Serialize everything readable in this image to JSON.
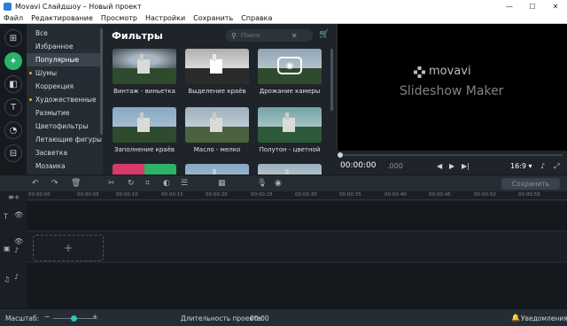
{
  "window": {
    "title": "Movavi Слайдшоу – Новый проект",
    "buttons": [
      "—",
      "☐",
      "✕"
    ]
  },
  "menu": [
    "Файл",
    "Редактирование",
    "Просмотр",
    "Настройки",
    "Сохранить",
    "Справка"
  ],
  "rail_tools": [
    "import-icon",
    "filters-icon",
    "transitions-icon",
    "titles-icon",
    "stickers-icon",
    "more-tools-icon"
  ],
  "categories": {
    "items": [
      {
        "label": "Все",
        "dot": false
      },
      {
        "label": "Избранное",
        "dot": false
      },
      {
        "label": "Популярные",
        "dot": false
      },
      {
        "label": "Шумы",
        "dot": true
      },
      {
        "label": "Коррекция",
        "dot": false
      },
      {
        "label": "Художественные",
        "dot": true
      },
      {
        "label": "Размытие",
        "dot": false
      },
      {
        "label": "Цветофильтры",
        "dot": false
      },
      {
        "label": "Летающие фигуры",
        "dot": false
      },
      {
        "label": "Засветка",
        "dot": false
      },
      {
        "label": "Мозаика",
        "dot": false
      }
    ],
    "selected": "Популярные"
  },
  "filters": {
    "title": "Фильтры",
    "search_placeholder": "Поиск",
    "items": [
      {
        "label": "Винтаж - виньетка"
      },
      {
        "label": "Выделение краёв"
      },
      {
        "label": "Дрожание камеры"
      },
      {
        "label": "Заполнение краёв"
      },
      {
        "label": "Масло - мелко"
      },
      {
        "label": "Полутон - цветной"
      },
      {
        "label": ""
      },
      {
        "label": ""
      },
      {
        "label": ""
      }
    ]
  },
  "preview": {
    "brand": "movavi",
    "product": "Slideshow Maker",
    "time_main": "00:00:00",
    "time_ms": ".000",
    "aspect_ratio": "16:9"
  },
  "timeline": {
    "save_label": "Сохранить",
    "ticks": [
      "00:00:00",
      "00:00:05",
      "00:00:10",
      "00:00:15",
      "00:00:20",
      "00:00:25",
      "00:00:30",
      "00:00:35",
      "00:00:40",
      "00:00:45",
      "00:00:50",
      "00:00:55"
    ]
  },
  "status": {
    "zoom_label": "Масштаб:",
    "zoom_level": 0.45,
    "duration_label": "Длительность проекта:",
    "duration_value": "00:00",
    "notifications": "Уведомления"
  }
}
